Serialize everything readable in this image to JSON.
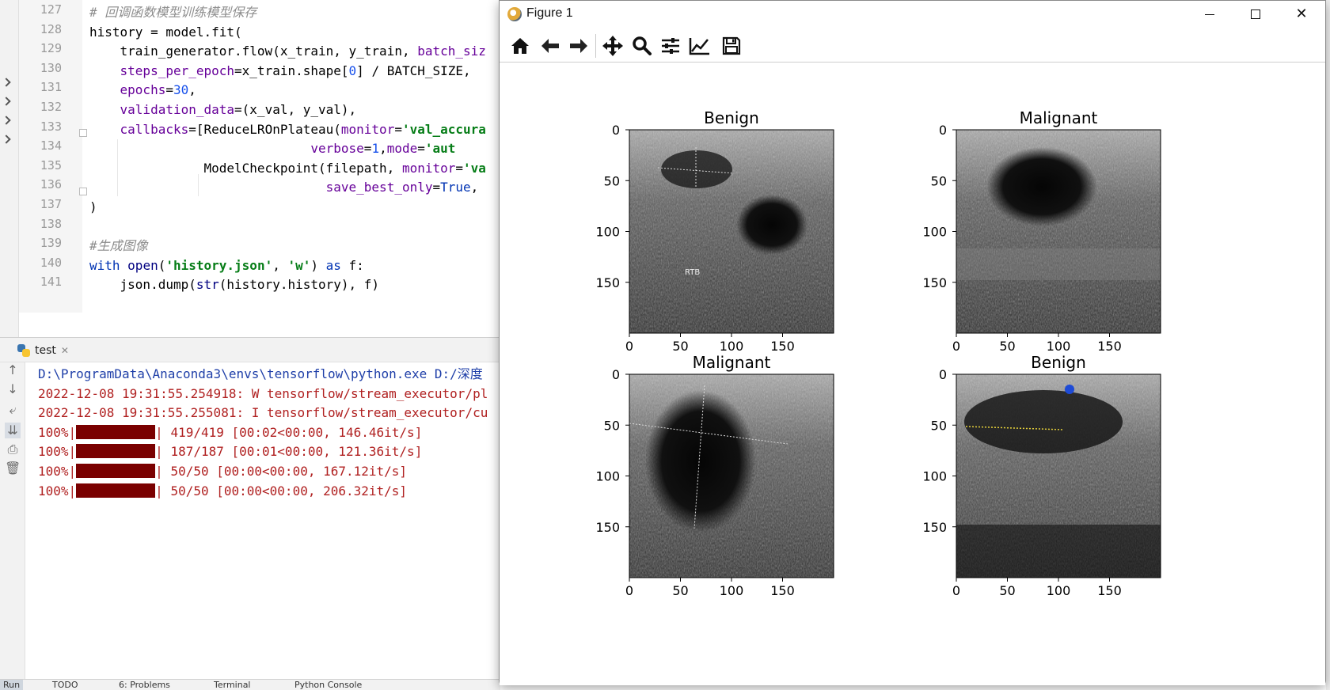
{
  "ide": {
    "corner_label": "深",
    "gutter_line_numbers": [
      "127",
      "128",
      "129",
      "130",
      "131",
      "132",
      "133",
      "134",
      "135",
      "136",
      "137",
      "138",
      "139",
      "140",
      "141"
    ],
    "code_lines": [
      [
        {
          "t": "# 回调函数模型训练模型保存",
          "c": "cm"
        }
      ],
      [
        {
          "t": "history = model.fit(",
          "c": ""
        }
      ],
      [
        {
          "t": "    train_generator.flow(x_train, y_train, ",
          "c": ""
        },
        {
          "t": "batch_siz",
          "c": "pa"
        }
      ],
      [
        {
          "t": "    ",
          "c": ""
        },
        {
          "t": "steps_per_epoch",
          "c": "pa"
        },
        {
          "t": "=x_train.shape[",
          "c": ""
        },
        {
          "t": "0",
          "c": "nu"
        },
        {
          "t": "] / BATCH_SIZE,",
          "c": ""
        }
      ],
      [
        {
          "t": "    ",
          "c": ""
        },
        {
          "t": "epochs",
          "c": "pa"
        },
        {
          "t": "=",
          "c": ""
        },
        {
          "t": "30",
          "c": "nu"
        },
        {
          "t": ",",
          "c": ""
        }
      ],
      [
        {
          "t": "    ",
          "c": ""
        },
        {
          "t": "validation_data",
          "c": "pa"
        },
        {
          "t": "=(x_val, y_val),",
          "c": ""
        }
      ],
      [
        {
          "t": "    ",
          "c": ""
        },
        {
          "t": "callbacks",
          "c": "pa"
        },
        {
          "t": "=[ReduceLROnPlateau(",
          "c": ""
        },
        {
          "t": "monitor",
          "c": "pa"
        },
        {
          "t": "=",
          "c": ""
        },
        {
          "t": "'val_accura",
          "c": "st"
        }
      ],
      [
        {
          "t": "                             ",
          "c": ""
        },
        {
          "t": "verbose",
          "c": "pa"
        },
        {
          "t": "=",
          "c": ""
        },
        {
          "t": "1",
          "c": "nu"
        },
        {
          "t": ",",
          "c": ""
        },
        {
          "t": "mode",
          "c": "pa"
        },
        {
          "t": "=",
          "c": ""
        },
        {
          "t": "'aut",
          "c": "st"
        }
      ],
      [
        {
          "t": "               ModelCheckpoint(filepath, ",
          "c": ""
        },
        {
          "t": "monitor",
          "c": "pa"
        },
        {
          "t": "=",
          "c": ""
        },
        {
          "t": "'va",
          "c": "st"
        }
      ],
      [
        {
          "t": "                               ",
          "c": ""
        },
        {
          "t": "save_best_only",
          "c": "pa"
        },
        {
          "t": "=",
          "c": ""
        },
        {
          "t": "True",
          "c": "kw"
        },
        {
          "t": ",",
          "c": ""
        }
      ],
      [
        {
          "t": ")",
          "c": ""
        }
      ],
      [
        {
          "t": "",
          "c": ""
        }
      ],
      [
        {
          "t": "#生成图像",
          "c": "cm"
        }
      ],
      [
        {
          "t": "with",
          "c": "kw"
        },
        {
          "t": " ",
          "c": ""
        },
        {
          "t": "open",
          "c": "bi"
        },
        {
          "t": "(",
          "c": ""
        },
        {
          "t": "'history.json'",
          "c": "st"
        },
        {
          "t": ", ",
          "c": ""
        },
        {
          "t": "'w'",
          "c": "st"
        },
        {
          "t": ") ",
          "c": ""
        },
        {
          "t": "as",
          "c": "kw"
        },
        {
          "t": " f:",
          "c": ""
        }
      ],
      [
        {
          "t": "    json.dump(",
          "c": ""
        },
        {
          "t": "str",
          "c": "bi"
        },
        {
          "t": "(history.history), f)",
          "c": ""
        }
      ]
    ]
  },
  "run": {
    "tab_label": "test",
    "console_lines": [
      {
        "text": "D:\\ProgramData\\Anaconda3\\envs\\tensorflow\\python.exe D:/深度",
        "kind": "path"
      },
      {
        "text": "2022-12-08 19:31:55.254918: W tensorflow/stream_executor/pl",
        "kind": "err"
      },
      {
        "text": "2022-12-08 19:31:55.255081: I tensorflow/stream_executor/cu",
        "kind": "err"
      },
      {
        "prefix": "100%|",
        "suffix": "| 419/419 [00:02<00:00, 146.46it/s]",
        "progress": 1.0,
        "kind": "bar"
      },
      {
        "prefix": "100%|",
        "suffix": "| 187/187 [00:01<00:00, 121.36it/s]",
        "progress": 1.0,
        "kind": "bar"
      },
      {
        "prefix": "100%|",
        "suffix": "| 50/50 [00:00<00:00, 167.12it/s]",
        "progress": 1.0,
        "kind": "bar"
      },
      {
        "prefix": "100%|",
        "suffix": "| 50/50 [00:00<00:00, 206.32it/s]",
        "progress": 1.0,
        "kind": "bar"
      }
    ],
    "sidebar_icons": [
      "up-arrow-icon",
      "down-arrow-icon",
      "soft-wrap-icon",
      "scroll-to-end-icon",
      "print-icon",
      "trash-icon"
    ]
  },
  "status_bar": {
    "items": [
      "Run",
      "TODO",
      "6: Problems",
      "Terminal",
      "Python Console"
    ]
  },
  "figure_window": {
    "title": "Figure 1",
    "toolbar_icons": [
      "home-icon",
      "back-icon",
      "forward-icon",
      "pan-icon",
      "zoom-icon",
      "configure-subplots-icon",
      "edit-axes-icon",
      "save-icon"
    ],
    "colors": {
      "accent_bar": "#7a0000",
      "code_param": "#660099",
      "code_string": "#067d17",
      "code_keyword": "#0033b3"
    }
  },
  "chart_data": [
    {
      "type": "image",
      "title": "Benign",
      "xticks": [
        "0",
        "50",
        "100",
        "150"
      ],
      "yticks": [
        "0",
        "50",
        "100",
        "150"
      ],
      "xlim": [
        0,
        200
      ],
      "ylim": [
        200,
        0
      ],
      "annotation": "RTB"
    },
    {
      "type": "image",
      "title": "Malignant",
      "xticks": [
        "0",
        "50",
        "100",
        "150"
      ],
      "yticks": [
        "0",
        "50",
        "100",
        "150"
      ],
      "xlim": [
        0,
        200
      ],
      "ylim": [
        200,
        0
      ]
    },
    {
      "type": "image",
      "title": "Malignant",
      "xticks": [
        "0",
        "50",
        "100",
        "150"
      ],
      "yticks": [
        "0",
        "50",
        "100",
        "150"
      ],
      "xlim": [
        0,
        200
      ],
      "ylim": [
        200,
        0
      ]
    },
    {
      "type": "image",
      "title": "Benign",
      "xticks": [
        "0",
        "50",
        "100",
        "150"
      ],
      "yticks": [
        "0",
        "50",
        "100",
        "150"
      ],
      "xlim": [
        0,
        200
      ],
      "ylim": [
        200,
        0
      ]
    }
  ]
}
